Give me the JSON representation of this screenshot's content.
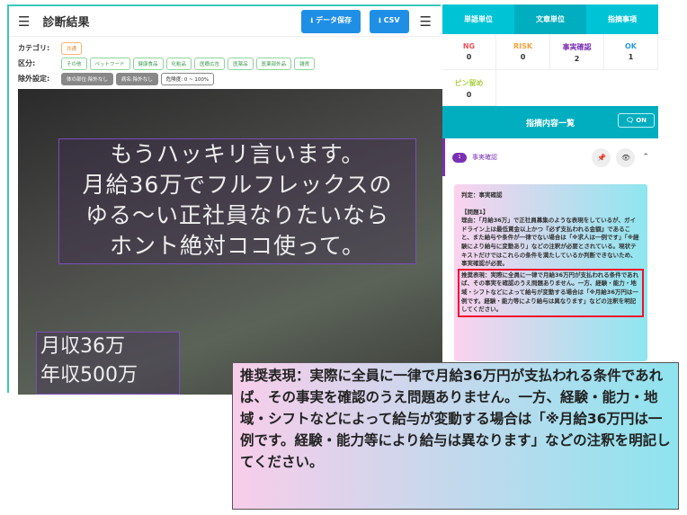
{
  "header": {
    "title": "診断結果",
    "save_label": "データ保存",
    "csv_label": "CSV"
  },
  "filters": {
    "category_label": "カテゴリ:",
    "category_chip": "共通",
    "division_label": "区分:",
    "division_chips": [
      "その他",
      "ペットフード",
      "健康食品",
      "化粧品",
      "医療広告",
      "医薬品",
      "医薬部外品",
      "雑貨"
    ],
    "exclude_label": "除外設定:",
    "exclude_chips": [
      "体の部位:除外なし",
      "病名:除外なし",
      "危険度: 0 ~ 100%"
    ]
  },
  "image_text": {
    "main": [
      "もうハッキリ言います。",
      "月給36万でフルフレックスの",
      "ゆる〜い正社員なりたいなら",
      "ホント絶対ココ使って。"
    ],
    "bottom": [
      "月収36万",
      "年収500万"
    ]
  },
  "right": {
    "tabs": [
      "単語単位",
      "文章単位",
      "指摘事項"
    ],
    "stats": [
      {
        "label": "NG",
        "value": "0",
        "color": "#f0505a"
      },
      {
        "label": "RISK",
        "value": "0",
        "color": "#f5a040"
      },
      {
        "label": "事実確認",
        "value": "2",
        "color": "#7a2fb5"
      },
      {
        "label": "OK",
        "value": "1",
        "color": "#2a9ae0"
      },
      {
        "label": "ピン留め",
        "value": "0",
        "color": "#a8d040"
      }
    ],
    "list_title": "指摘内容一覧",
    "on_label": "ON",
    "item": {
      "number": "1",
      "label": "事実確認"
    },
    "card": {
      "verdict": "判定：事実確認",
      "issue_title": "【問題1】",
      "reason": "理由：「月給36万」で正社員募集のような表現をしているが、ガイドライン上は最低賃金以上かつ『必ず支払われる金額』であること、また給与や条件が一律でない場合は「※求人は一例です」「※経験により給与に変動あり」などの注釈が必要とされている。現状テキストだけではこれらの条件を満たしているか判断できないため、事実確認が必要。",
      "recommend": "推奨表現：実際に全員に一律で月給36万円が支払われる条件であれば、その事実を確認のうえ問題ありません。一方、経験・能力・地域・シフトなどによって給与が変動する場合は「※月給36万円は一例です。経験・能力等により給与は異なります」などの注釈を明記してください。"
    }
  },
  "callout": "推奨表現：実際に全員に一律で月給36万円が支払われる条件であれば、その事実を確認のうえ問題ありません。一方、経験・能力・地域・シフトなどによって給与が変動する場合は「※月給36万円は一例です。経験・能力等により給与は異なります」などの注釈を明記してください。"
}
